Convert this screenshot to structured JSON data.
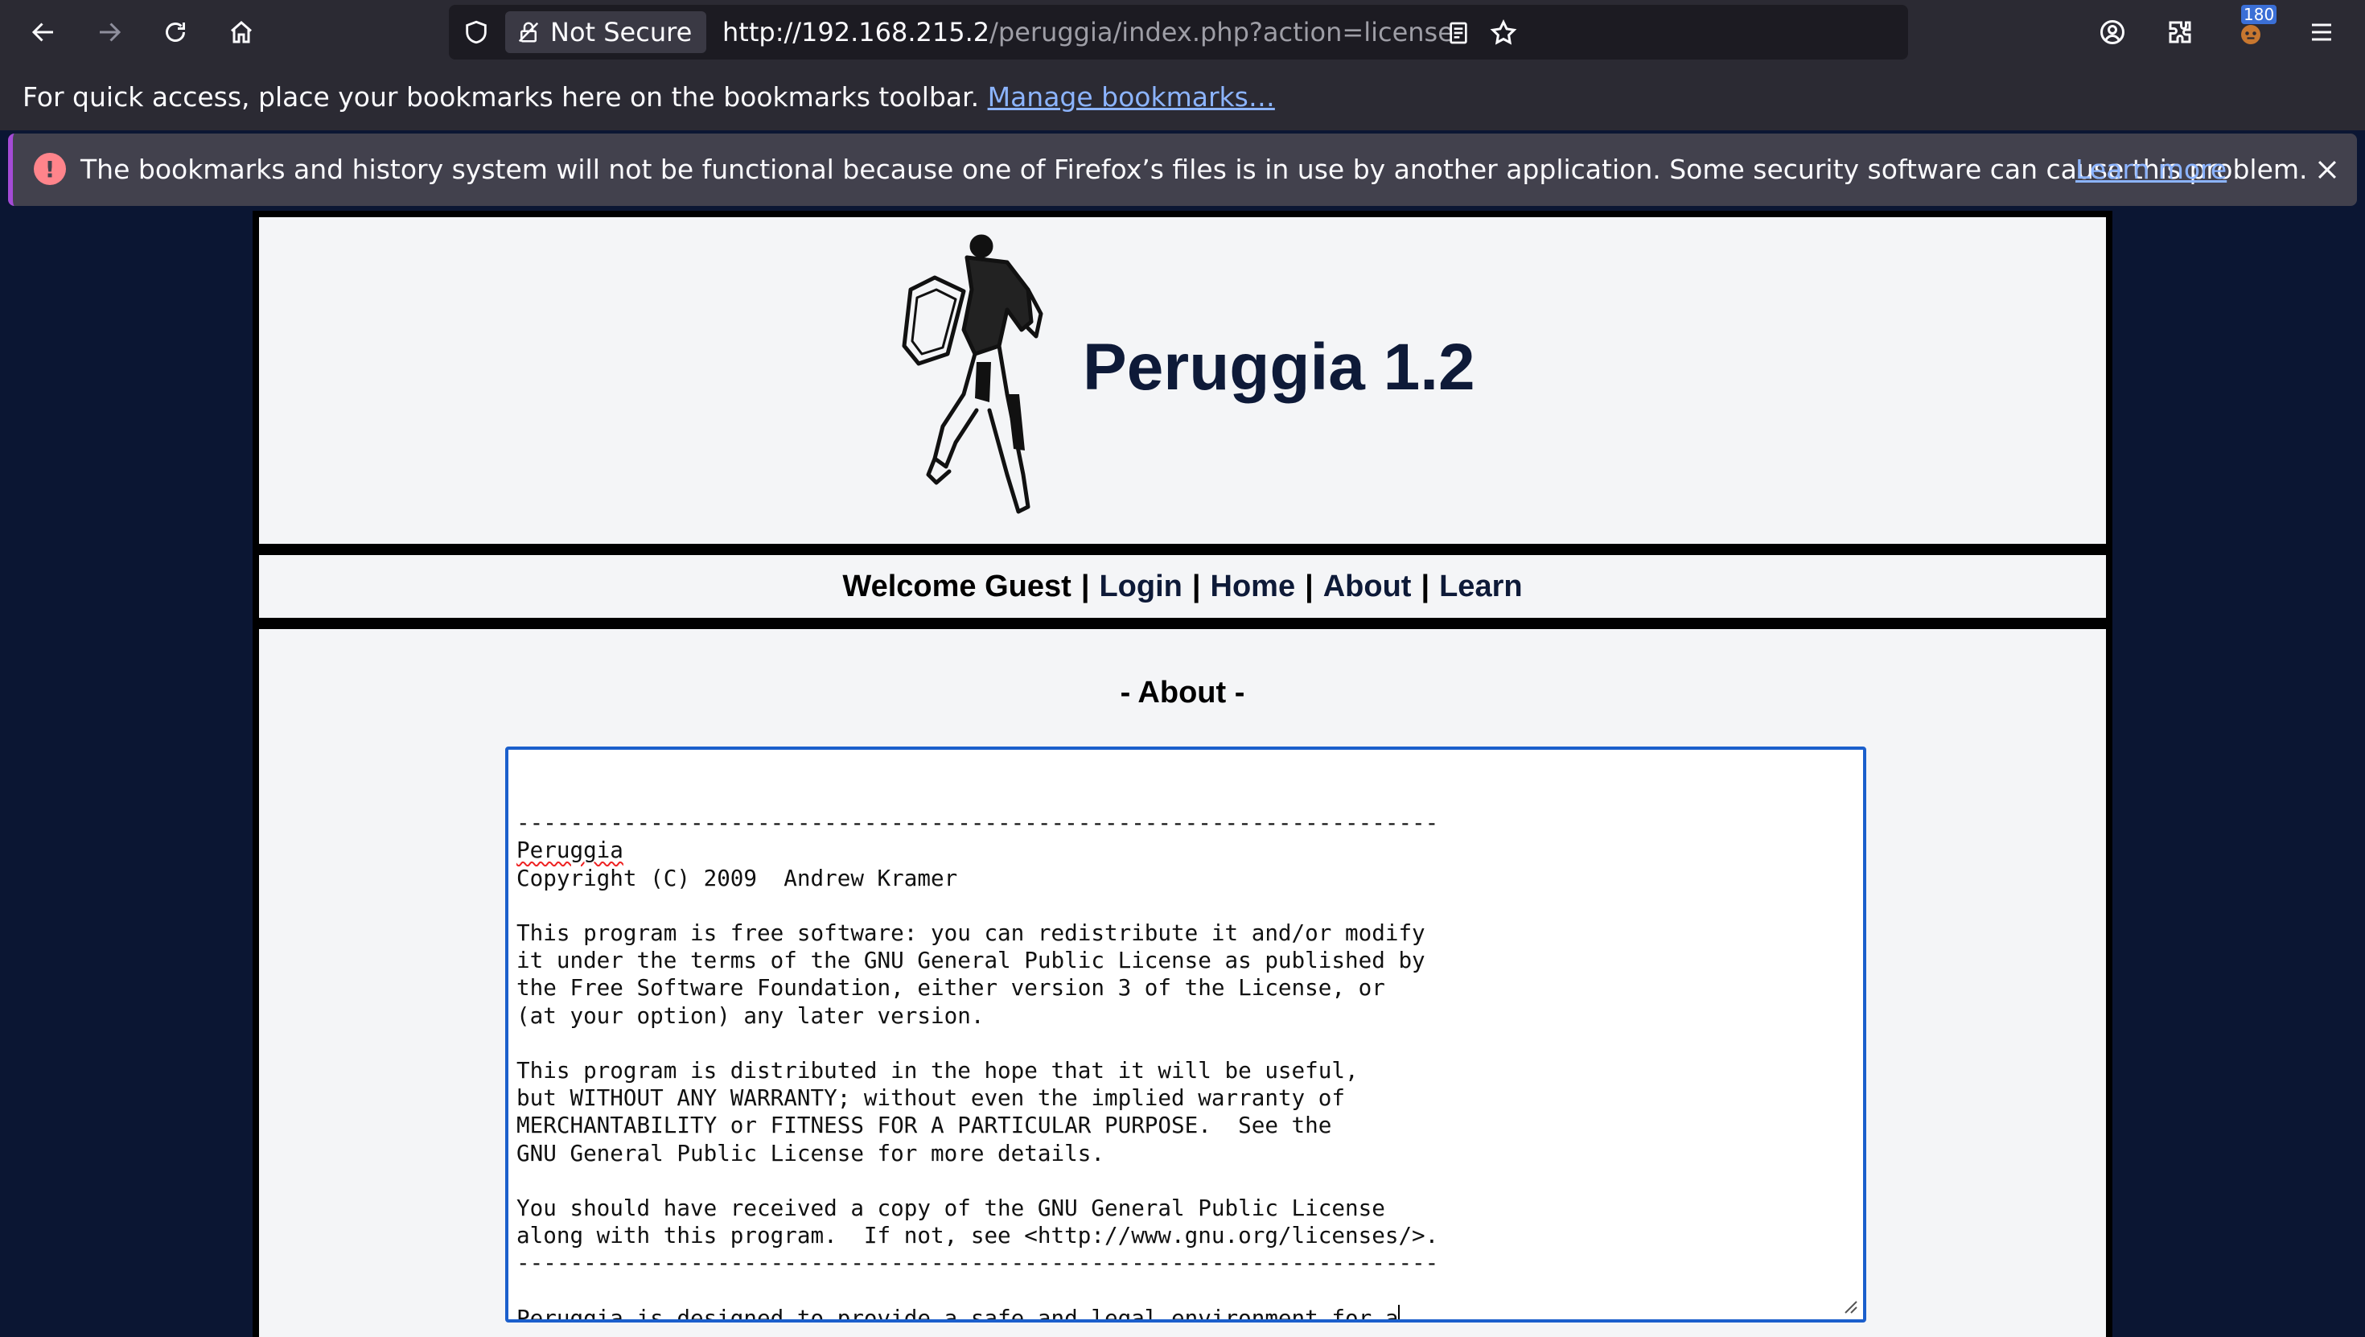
{
  "browser": {
    "security_label": "Not Secure",
    "url_host": "http://192.168.215.2",
    "url_path": "/peruggia/index.php?action=license",
    "extension_badge": "180",
    "icons": [
      "back-icon",
      "forward-icon",
      "reload-icon",
      "home-icon",
      "shield-icon",
      "lock-icon",
      "reader-view-icon",
      "star-icon",
      "account-icon",
      "extensions-icon",
      "extension-badge-icon",
      "menu-icon"
    ]
  },
  "bookmarks_bar": {
    "message": "For quick access, place your bookmarks here on the bookmarks toolbar.",
    "manage_link": "Manage bookmarks…"
  },
  "notification": {
    "message": "The bookmarks and history system will not be functional because one of Firefox’s files is in use by another application. Some security software can cause this problem.",
    "learn_more": "Learn more",
    "accent_color": "#a44bd6",
    "icon_color": "#ff848b"
  },
  "site": {
    "title": "Peruggia 1.2",
    "nav": {
      "welcome": "Welcome Guest",
      "separator": "|",
      "links": [
        "Login",
        "Home",
        "About",
        "Learn"
      ]
    },
    "section_heading": "- About -",
    "license_lines": [
      "",
      "---------------------------------------------------------------------",
      "Peruggia",
      "Copyright (C) 2009  Andrew Kramer",
      "",
      "This program is free software: you can redistribute it and/or modify",
      "it under the terms of the GNU General Public License as published by",
      "the Free Software Foundation, either version 3 of the License, or",
      "(at your option) any later version.",
      "",
      "This program is distributed in the hope that it will be useful,",
      "but WITHOUT ANY WARRANTY; without even the implied warranty of",
      "MERCHANTABILITY or FITNESS FOR A PARTICULAR PURPOSE.  See the",
      "GNU General Public License for more details.",
      "",
      "You should have received a copy of the GNU General Public License",
      "along with this program.  If not, see <http://www.gnu.org/licenses/>.",
      "---------------------------------------------------------------------",
      "",
      "Peruggia is designed to provide a safe and legal environment for a"
    ],
    "colors": {
      "page_bg": "#0b1633",
      "panel_bg": "#f4f5f7",
      "title_color": "#0e1a38",
      "focus_border": "#1b5fcc"
    }
  }
}
